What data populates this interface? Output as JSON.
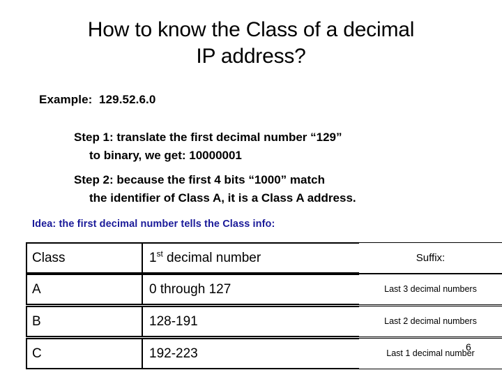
{
  "slide": {
    "title_line_1": "How to know the Class of a decimal",
    "title_line_2": "IP address?",
    "example": "Example:  129.52.6.0",
    "step_1_line_1": "Step 1:  translate the first decimal number “129”",
    "step_1_line_2": "to binary, we get: 10000001",
    "step_2_line_1": "Step 2:  because the first 4 bits “1000” match",
    "step_2_line_2": "the identifier of Class A, it is a Class A address.",
    "idea": "Idea: the first decimal number tells the Class info:",
    "idea_color": "#1a1a99",
    "slide_number": "6"
  },
  "table": {
    "headers": {
      "class": "Class",
      "decimal_prefix": "1",
      "decimal_ordinal": "st",
      "decimal_suffix": " decimal number",
      "suffix": "Suffix:"
    },
    "rows": [
      {
        "class": "A",
        "range": "0 through 127",
        "suffix": "Last 3 decimal numbers"
      },
      {
        "class": "B",
        "range": "128-191",
        "suffix": "Last 2 decimal numbers"
      },
      {
        "class": "C",
        "range": "192-223",
        "suffix": "Last 1 decimal number"
      }
    ]
  }
}
